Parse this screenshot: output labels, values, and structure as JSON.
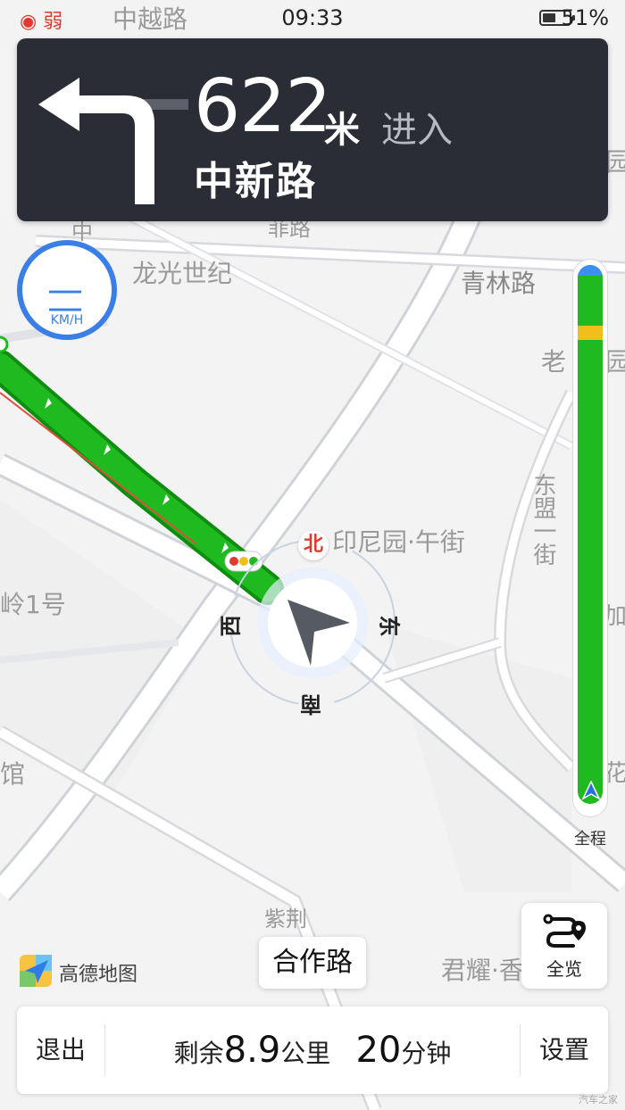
{
  "status_bar": {
    "signal": "弱",
    "time": "09:33",
    "battery": "51%",
    "battery_level": 0.51
  },
  "navigation": {
    "distance": "622",
    "unit": "米",
    "action": "进入",
    "road": "中新路",
    "turn_icon": "turn-left-icon"
  },
  "speed": {
    "value": "— —",
    "unit": "KM/H"
  },
  "map": {
    "labels": {
      "zhongyue": "中越路",
      "longguang": "龙光世纪",
      "qinglin": "青林路",
      "lao": "老",
      "yuan_top": "园",
      "yuan_mid": "园",
      "feilu": "菲路",
      "yinniyuan": "印尼园·午街",
      "ling1": "岭1号",
      "dongmeng": "东盟一街",
      "guan": "馆",
      "ziyi": "紫荆",
      "junyao": "君耀·香",
      "zhong": "中",
      "right_edge": "加",
      "right_lower": "花"
    },
    "compass": {
      "north": "北",
      "east": "东",
      "south": "南",
      "west": "西"
    }
  },
  "route_progress": {
    "label": "全程",
    "progress": 0.98
  },
  "overview_button": {
    "label": "全览"
  },
  "current_road": "合作路",
  "brand": "高德地图",
  "bottom_bar": {
    "exit": "退出",
    "remain_prefix": "剩余",
    "remain_distance": "8.9",
    "distance_unit": "公里",
    "remain_time": "20",
    "time_unit": "分钟",
    "settings": "设置"
  },
  "watermark": "汽车之家",
  "colors": {
    "route": "#1fba1f",
    "accent": "#3a7fe8",
    "panel": "#2b2d36",
    "congestion": "#f2be1c"
  }
}
